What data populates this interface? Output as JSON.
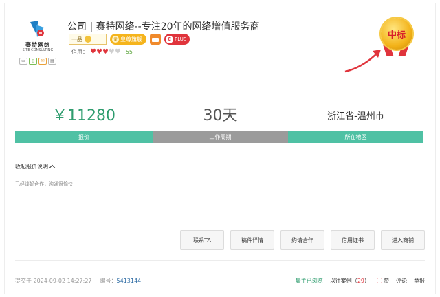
{
  "company": {
    "logo_cn": "赛特网络",
    "logo_en": "SITE CONSULTING",
    "title": "公司 | 赛特网络--专注20年的网络增值服务商"
  },
  "badges": {
    "yipin": "一品",
    "gold": "皇尊旗舰",
    "plus": "PLUS"
  },
  "credit": {
    "label": "信用：",
    "hearts_on": 3,
    "hearts_total": 5,
    "score": "55"
  },
  "medal": {
    "text": "中标"
  },
  "stats": {
    "price": "￥11280",
    "price_label": "报价",
    "period": "30天",
    "period_label": "工作周期",
    "region": "浙江省-温州市",
    "region_label": "所在地区"
  },
  "details": {
    "toggle_label": "收起报价说明",
    "description": "已经谈好合作，沟通很愉快"
  },
  "actions": [
    "联系TA",
    "稿件详情",
    "约请合作",
    "信用证书",
    "进入商铺"
  ],
  "footer": {
    "submitted": "提交于 2024-09-02 14:27:27",
    "id_label": "编号：",
    "id_value": "5413144",
    "status": "雇主已浏览",
    "past_cases_label": "以往案例（",
    "past_cases_count": "29",
    "past_cases_end": "）",
    "like": "赞",
    "comment": "评论",
    "report": "举报"
  },
  "colors": {
    "accent_green": "#4fc1a4",
    "price_green": "#2e9c6e",
    "gray_bar": "#9b9b9b",
    "red": "#e0343c",
    "gold": "#f5b41c"
  }
}
